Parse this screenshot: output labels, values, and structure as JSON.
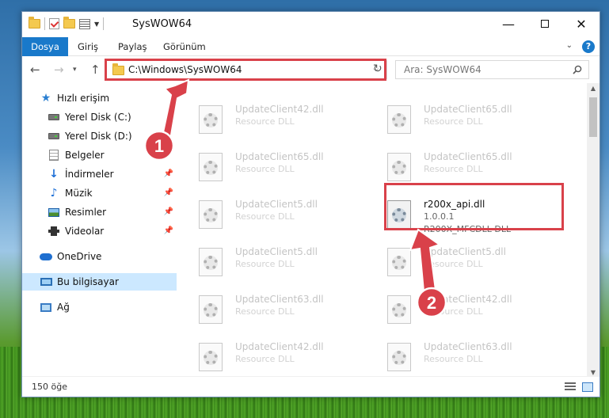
{
  "window": {
    "title": "SysWOW64",
    "minimize": "—",
    "close": "✕"
  },
  "ribbon": {
    "tabs": [
      "Dosya",
      "Giriş",
      "Paylaş",
      "Görünüm"
    ],
    "help": "?"
  },
  "nav": {
    "back": "←",
    "forward": "→",
    "recent": "▾",
    "up": "↑",
    "address": "C:\\Windows\\SysWOW64",
    "address_caret": "⌵",
    "refresh": "↻",
    "search_placeholder": "Ara: SysWOW64"
  },
  "sidebar": {
    "items": [
      {
        "label": "Hızlı erişim",
        "icon": "star-icon"
      },
      {
        "label": "Yerel Disk (C:)",
        "icon": "disk-icon"
      },
      {
        "label": "Yerel Disk (D:)",
        "icon": "disk-icon"
      },
      {
        "label": "Belgeler",
        "icon": "document-icon"
      },
      {
        "label": "İndirmeler",
        "icon": "download-icon"
      },
      {
        "label": "Müzik",
        "icon": "music-icon"
      },
      {
        "label": "Resimler",
        "icon": "picture-icon"
      },
      {
        "label": "Videolar",
        "icon": "video-icon"
      },
      {
        "label": "OneDrive",
        "icon": "cloud-icon"
      },
      {
        "label": "Bu bilgisayar",
        "icon": "computer-icon"
      },
      {
        "label": "Ağ",
        "icon": "network-icon"
      }
    ],
    "pin": "📌"
  },
  "files": [
    {
      "name": "UpdateClient42.dll",
      "type": "Resource DLL"
    },
    {
      "name": "UpdateClient65.dll",
      "type": "Resource DLL"
    },
    {
      "name": "UpdateClient65.dll",
      "type": "Resource DLL"
    },
    {
      "name": "UpdateClient65.dll",
      "type": "Resource DLL"
    },
    {
      "name": "UpdateClient5.dll",
      "type": "Resource DLL"
    },
    {
      "name": "r200x_api.dll",
      "type": "1.0.0.1",
      "sub": "R200X_MFCDLL DLL"
    },
    {
      "name": "UpdateClient5.dll",
      "type": "Resource DLL"
    },
    {
      "name": "UpdateClient5.dll",
      "type": "Resource DLL"
    },
    {
      "name": "UpdateClient63.dll",
      "type": "Resource DLL"
    },
    {
      "name": "UpdateClient42.dll",
      "type": "Resource DLL"
    },
    {
      "name": "UpdateClient42.dll",
      "type": "Resource DLL"
    },
    {
      "name": "UpdateClient63.dll",
      "type": "Resource DLL"
    }
  ],
  "annotations": {
    "step1": "1",
    "step2": "2",
    "color": "#d9414a"
  },
  "scrollbar": {
    "up": "▲",
    "down": "▼"
  },
  "status": {
    "count": "150 öğe"
  }
}
